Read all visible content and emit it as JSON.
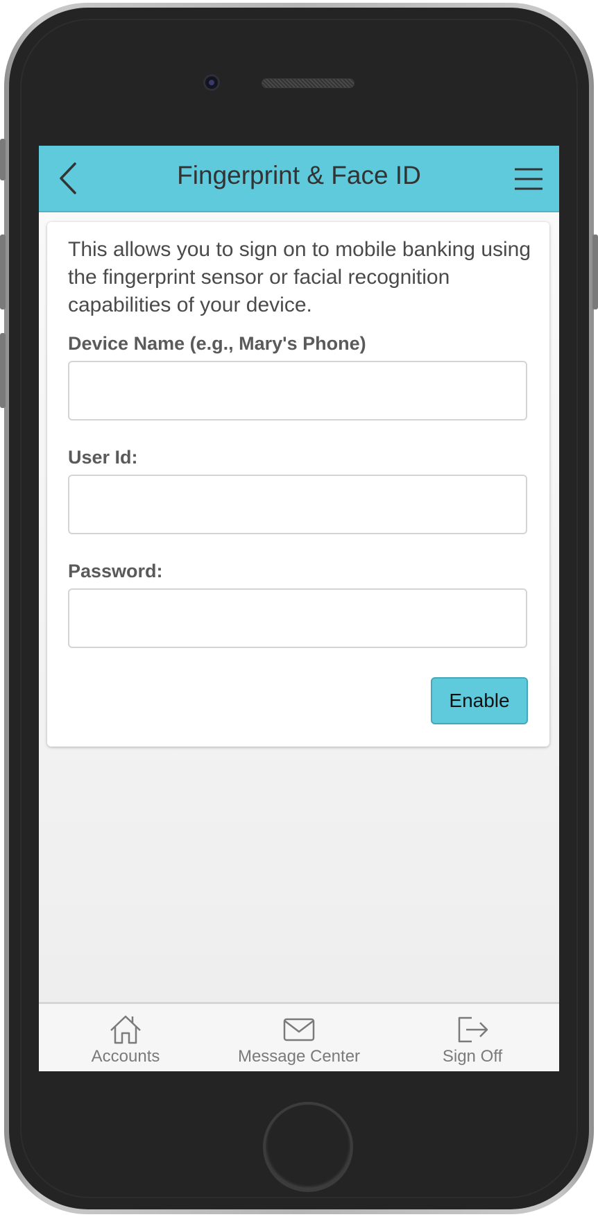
{
  "header": {
    "title": "Fingerprint & Face ID",
    "back_icon": "chevron-left-icon",
    "menu_icon": "hamburger-menu-icon",
    "color": "#5ecadc"
  },
  "form": {
    "intro": "This allows you to sign on to mobile banking using the fingerprint sensor or facial recognition capabilities of your device.",
    "device_name_label": "Device Name (e.g., Mary's Phone)",
    "device_name_value": "",
    "user_id_label": "User Id:",
    "user_id_value": "",
    "password_label": "Password:",
    "password_value": "",
    "enable_label": "Enable"
  },
  "tabbar": {
    "items": [
      {
        "label": "Accounts",
        "icon": "home-icon"
      },
      {
        "label": "Message Center",
        "icon": "envelope-icon"
      },
      {
        "label": "Sign Off",
        "icon": "sign-out-icon"
      }
    ]
  }
}
